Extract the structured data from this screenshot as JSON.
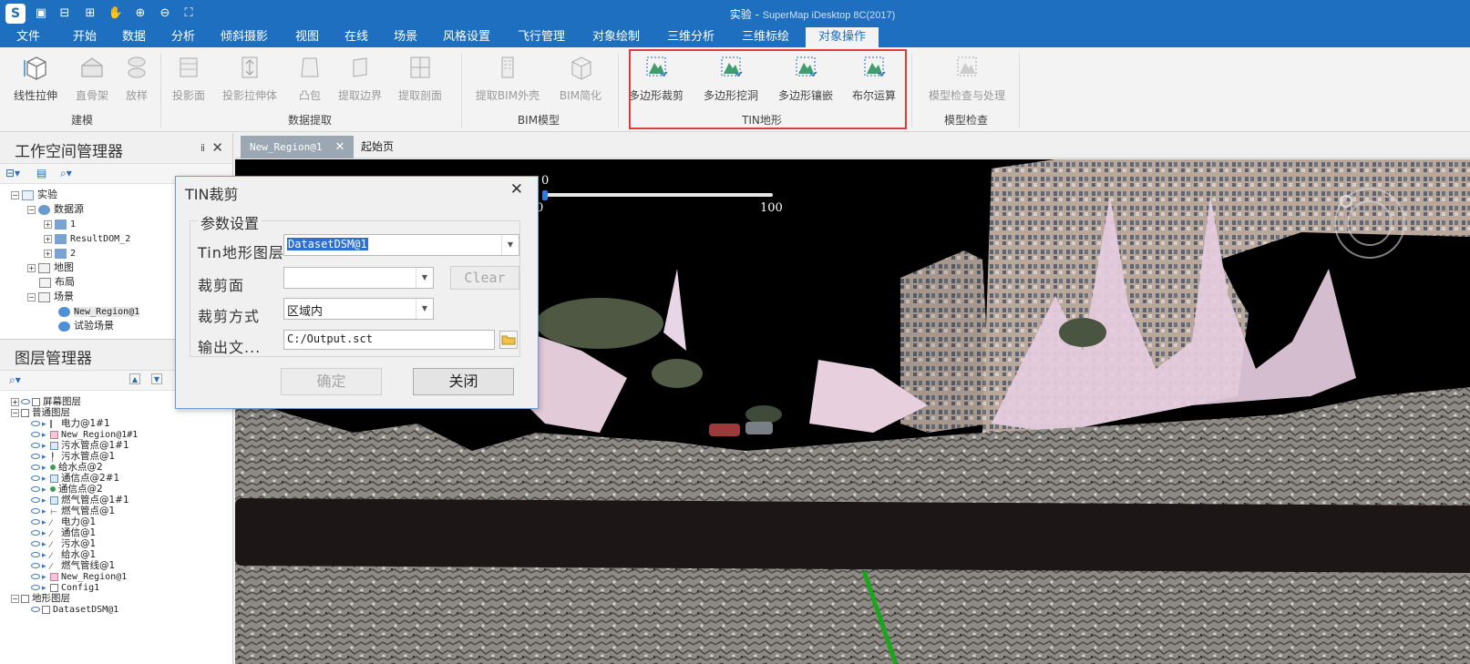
{
  "window": {
    "title": "实验",
    "brand": "SuperMap iDesktop 8C(2017)"
  },
  "menu": {
    "tabs": [
      "文件",
      "开始",
      "数据",
      "分析",
      "倾斜摄影",
      "视图",
      "在线",
      "场景",
      "风格设置",
      "飞行管理",
      "对象绘制",
      "三维分析",
      "三维标绘",
      "对象操作"
    ],
    "active": "对象操作"
  },
  "ribbon": {
    "groups": {
      "modeling": "建模",
      "extract": "数据提取",
      "bim": "BIM模型",
      "tin": "TIN地形",
      "check": "模型检查"
    },
    "buttons": {
      "linear_extrude": "线性拉伸",
      "skeleton": "直骨架",
      "loft": "放样",
      "projection": "投影面",
      "projection_extrude": "投影拉伸体",
      "convex": "凸包",
      "extract_boundary": "提取边界",
      "extract_section": "提取剖面",
      "bim_outline": "提取BIM外壳",
      "bim_simplify": "BIM简化",
      "poly_clip": "多边形裁剪",
      "poly_hole": "多边形挖洞",
      "poly_inlay": "多边形镶嵌",
      "boolean": "布尔运算",
      "model_check": "模型检查与处理"
    }
  },
  "workspace": {
    "title": "工作空间管理器",
    "tree": {
      "root": "实验",
      "datasources": "数据源",
      "ds1": "1",
      "ds2": "ResultDOM_2",
      "ds3": "2",
      "maps": "地图",
      "layouts": "布局",
      "scenes": "场景",
      "scene1": "New_Region@1",
      "scene2": "试验场景"
    }
  },
  "layers": {
    "title": "图层管理器",
    "groups": {
      "screen": "屏幕图层",
      "normal": "普通图层",
      "terrain": "地形图层"
    },
    "items": [
      "电力@1#1",
      "New_Region@1#1",
      "污水管点@1#1",
      "污水管点@1",
      "给水点@2",
      "通信点@2#1",
      "通信点@2",
      "燃气管点@1#1",
      "燃气管点@1",
      "电力@1",
      "通信@1",
      "污水@1",
      "给水@1",
      "燃气管线@1",
      "New_Region@1",
      "Config1"
    ],
    "terrain_item": "DatasetDSM@1"
  },
  "doc_tabs": {
    "active": "New_Region@1",
    "other": "起始页"
  },
  "scene": {
    "slider_min": "0",
    "slider_max": "100",
    "slider_value": "0",
    "slider_fraction": 0
  },
  "dialog": {
    "title": "TIN裁剪",
    "group": "参数设置",
    "tin_label": "Tin地形图层",
    "tin_value": "DatasetDSM@1",
    "clip_face_label": "裁剪面",
    "clip_face_value": "",
    "clear_button": "Clear",
    "clip_mode_label": "裁剪方式",
    "clip_mode_value": "区域内",
    "output_label": "输出文...",
    "output_value": "C:/Output.sct",
    "ok_button": "确定",
    "close_button": "关闭"
  },
  "colors": {
    "accent": "#1e6fbf",
    "highlight_border": "#e23b3b",
    "scene_bg": "#000000"
  }
}
